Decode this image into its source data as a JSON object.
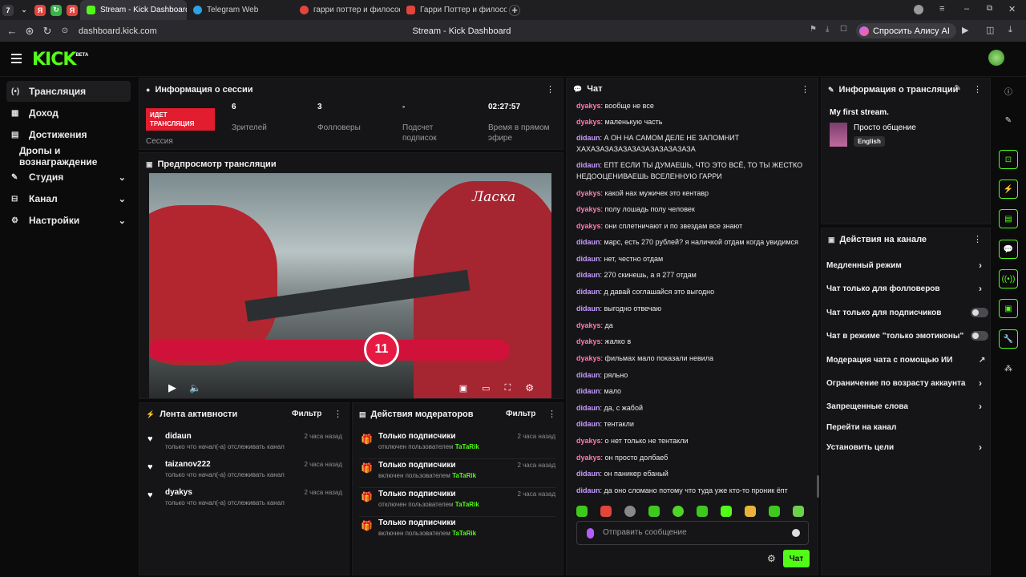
{
  "browser": {
    "tab_count": "7",
    "tabs": [
      {
        "label": "Stream - Kick Dashboard",
        "color": "#53fc18"
      },
      {
        "label": "Telegram Web",
        "color": "#2aa3e0"
      },
      {
        "label": "гарри поттер и философ",
        "color": "#e2453c"
      },
      {
        "label": "Гарри Поттер и филосо",
        "color": "#e2453c"
      }
    ],
    "url": "dashboard.kick.com",
    "page_title": "Stream - Kick Dashboard",
    "alice_label": "Спросить Алису AI"
  },
  "brand": {
    "logo": "KICK",
    "beta": "BETA",
    "accent": "#53fc18"
  },
  "sidebar": {
    "items": [
      {
        "label": "Трансляция",
        "icon": "broadcast-icon"
      },
      {
        "label": "Доход",
        "icon": "income-icon"
      },
      {
        "label": "Достижения",
        "icon": "achievements-icon"
      },
      {
        "label": "Дропы и вознаграждение",
        "icon": ""
      },
      {
        "label": "Студия",
        "icon": "chevron-down-icon"
      },
      {
        "label": "Канал",
        "icon": "chevron-down-icon"
      },
      {
        "label": "Настройки",
        "icon": "gear-icon"
      }
    ]
  },
  "session": {
    "title": "Информация о сессии",
    "live_badge": "ИДЕТ ТРАНСЛЯЦИЯ",
    "session_label": "Сессия",
    "stats": [
      {
        "value": "6",
        "label": "Зрителей"
      },
      {
        "value": "3",
        "label": "Фолловеры"
      },
      {
        "value": "-",
        "label": "Подсчет подписок"
      },
      {
        "value": "02:27:57",
        "label": "Время в прямом эфире"
      }
    ]
  },
  "preview": {
    "title": "Предпросмотр трансляции",
    "overlay_text": "Ласка",
    "counter": "11"
  },
  "activity": {
    "title": "Лента активности",
    "filter": "Фильтр",
    "items": [
      {
        "name": "didaun",
        "text": "только что начал(-а) отслеживать канал",
        "time": "2 часа назад"
      },
      {
        "name": "taizanov222",
        "text": "только что начал(-а) отслеживать канал",
        "time": "2 часа назад"
      },
      {
        "name": "dyakys",
        "text": "только что начал(-а) отслеживать канал",
        "time": "2 часа назад"
      }
    ]
  },
  "moderators": {
    "title": "Действия модераторов",
    "filter": "Фильтр",
    "items": [
      {
        "title": "Только подписчики",
        "action": "отключен пользователем",
        "user": "TaTaRik",
        "time": "2 часа назад"
      },
      {
        "title": "Только подписчики",
        "action": "включен пользователем",
        "user": "TaTaRik",
        "time": "2 часа назад"
      },
      {
        "title": "Только подписчики",
        "action": "отключен пользователем",
        "user": "TaTaRik",
        "time": "2 часа назад"
      },
      {
        "title": "Только подписчики",
        "action": "включен пользователем",
        "user": "TaTaRik",
        "time": ""
      }
    ]
  },
  "chat": {
    "title": "Чат",
    "messages": [
      {
        "user": "dyakys",
        "text": "вообще не все"
      },
      {
        "user": "dyakys",
        "text": "маленькую часть"
      },
      {
        "user": "didaun",
        "text": "А ОН НА САМОМ ДЕЛЕ НЕ ЗАПОМНИТ ХАХАЗАЗАЗАЗАЗАЗАЗАЗАЗАЗАЗА"
      },
      {
        "user": "didaun",
        "text": "ЕПТ ЕСЛИ ТЫ ДУМАЕШЬ, ЧТО ЭТО ВСЁ, ТО ТЫ ЖЕСТКО НЕДООЦЕНИВАЕШЬ ВСЕЛЕННУЮ ГАРРИ"
      },
      {
        "user": "dyakys",
        "text": "какой нах мужичек это кентавр"
      },
      {
        "user": "dyakys",
        "text": "полу лошадь полу человек"
      },
      {
        "user": "dyakys",
        "text": "они сплетничают и по звездам все знают"
      },
      {
        "user": "didaun",
        "text": "марс, есть 270 рублей? я наличкой отдам когда увидимся"
      },
      {
        "user": "didaun",
        "text": "нет, честно отдам"
      },
      {
        "user": "didaun",
        "text": "270 скинешь, а я 277 отдам"
      },
      {
        "user": "didaun",
        "text": "д давай соглашайся это выгодно"
      },
      {
        "user": "didaun",
        "text": "выгодно отвечаю"
      },
      {
        "user": "dyakys",
        "text": "да"
      },
      {
        "user": "dyakys",
        "text": "жалко в"
      },
      {
        "user": "dyakys",
        "text": "фильмах мало показали невила"
      },
      {
        "user": "didaun",
        "text": "ряльно"
      },
      {
        "user": "didaun",
        "text": "мало"
      },
      {
        "user": "didaun",
        "text": "да, с жабой"
      },
      {
        "user": "didaun",
        "text": "тентакли"
      },
      {
        "user": "dyakys",
        "text": "о нет только не тентакли"
      },
      {
        "user": "dyakys",
        "text": "он просто долбаеб"
      },
      {
        "user": "didaun",
        "text": "он паникер ебаный"
      },
      {
        "user": "didaun",
        "text": "да оно сломано потому что туда уже кто-то проник ёпт"
      }
    ],
    "input_placeholder": "Отправить сообщение",
    "send_label": "Чат"
  },
  "stream_info": {
    "title": "Информация о трансляции",
    "stream_title": "My first stream.",
    "category": "Просто общение",
    "language": "English"
  },
  "channel_actions": {
    "title": "Действия на канале",
    "items": [
      {
        "label": "Медленный режим",
        "control": "chevron"
      },
      {
        "label": "Чат только для фолловеров",
        "control": "chevron"
      },
      {
        "label": "Чат только для подписчиков",
        "control": "toggle"
      },
      {
        "label": "Чат в режиме \"только эмотиконы\"",
        "control": "toggle"
      },
      {
        "label": "Модерация чата с помощью ИИ",
        "control": "external"
      },
      {
        "label": "Ограничение по возрасту аккаунта",
        "control": "chevron"
      },
      {
        "label": "Запрещенные слова",
        "control": "chevron"
      },
      {
        "label": "Перейти на канал",
        "control": "none"
      },
      {
        "label": "Установить цели",
        "control": "chevron"
      }
    ]
  }
}
